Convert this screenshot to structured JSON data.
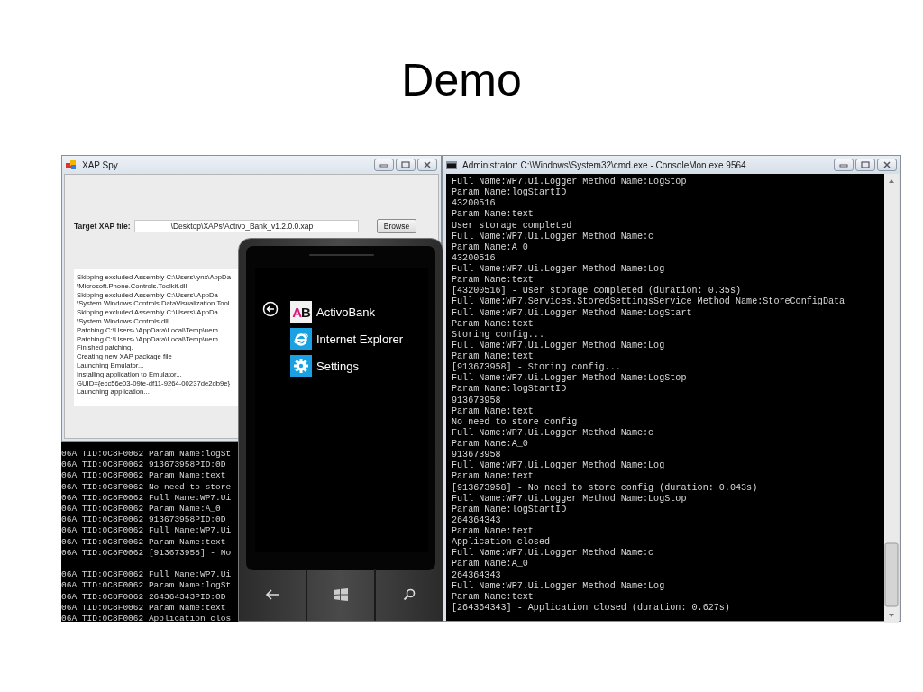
{
  "slide": {
    "title": "Demo"
  },
  "xap_spy": {
    "title": "XAP Spy",
    "target_label": "Target XAP file:",
    "target_value": "\\Desktop\\XAPs\\Activo_Bank_v1.2.0.0.xap",
    "browse_button": "Browse",
    "log": [
      "Skipping excluded Assembly C:\\Users\\lynx\\AppDa",
      "\\Microsoft.Phone.Controls.Toolkit.dll",
      "Skipping excluded Assembly C:\\Users\\      AppDa",
      "\\System.Windows.Controls.DataVisualization.Tool",
      "Skipping excluded Assembly C:\\Users\\      AppDa",
      "\\System.Windows.Controls.dll",
      "Patching C:\\Users\\      \\AppData\\Local\\Temp\\uem",
      "Patching C:\\Users\\      \\AppData\\Local\\Temp\\uem",
      "Finished patching.",
      "Creating new XAP package file",
      "Launching Emulator...",
      "Installing application to Emulator...",
      "GUID={ecc56e03-09fe-df11-9264-00237de2db9e}",
      "Launching application..."
    ]
  },
  "console_behind": {
    "blocks": [
      [
        "06A TID:0C8F0062 Param Name:logSt",
        "06A TID:0C8F0062 913673958PID:0D",
        "06A TID:0C8F0062 Param Name:text",
        "06A TID:0C8F0062 No need to store",
        "06A TID:0C8F0062 Full Name:WP7.Ui",
        "06A TID:0C8F0062 Param Name:A_0",
        "06A TID:0C8F0062 913673958PID:0D",
        "06A TID:0C8F0062 Full Name:WP7.Ui",
        "06A TID:0C8F0062 Param Name:text",
        "06A TID:0C8F0062 [913673958] - No"
      ],
      [
        "06A TID:0C8F0062 Full Name:WP7.Ui",
        "06A TID:0C8F0062 Param Name:logSt",
        "06A TID:0C8F0062 264364343PID:0D",
        "06A TID:0C8F0062 Param Name:text",
        "06A TID:0C8F0062 Application clos"
      ]
    ]
  },
  "phone": {
    "apps": [
      {
        "kind": "activobank",
        "tile_text": "AB",
        "label": "ActivoBank"
      },
      {
        "kind": "ie",
        "label": "Internet Explorer"
      },
      {
        "kind": "settings",
        "label": "Settings"
      }
    ]
  },
  "cmd": {
    "title": "Administrator: C:\\Windows\\System32\\cmd.exe - ConsoleMon.exe  9564",
    "lines": [
      "Full Name:WP7.Ui.Logger Method Name:LogStop",
      "Param Name:logStartID",
      "43200516",
      "Param Name:text",
      "User storage completed",
      "Full Name:WP7.Ui.Logger Method Name:c",
      "Param Name:A_0",
      "43200516",
      "Full Name:WP7.Ui.Logger Method Name:Log",
      "Param Name:text",
      "[43200516] - User storage completed (duration: 0.35s)",
      "Full Name:WP7.Services.StoredSettingsService Method Name:StoreConfigData",
      "Full Name:WP7.Ui.Logger Method Name:LogStart",
      "Param Name:text",
      "Storing config...",
      "Full Name:WP7.Ui.Logger Method Name:Log",
      "Param Name:text",
      "[913673958] - Storing config...",
      "Full Name:WP7.Ui.Logger Method Name:LogStop",
      "Param Name:logStartID",
      "913673958",
      "Param Name:text",
      "No need to store config",
      "Full Name:WP7.Ui.Logger Method Name:c",
      "Param Name:A_0",
      "913673958",
      "Full Name:WP7.Ui.Logger Method Name:Log",
      "Param Name:text",
      "[913673958] - No need to store config (duration: 0.043s)",
      "Full Name:WP7.Ui.Logger Method Name:LogStop",
      "Param Name:logStartID",
      "264364343",
      "Param Name:text",
      "Application closed",
      "Full Name:WP7.Ui.Logger Method Name:c",
      "Param Name:A_0",
      "264364343",
      "Full Name:WP7.Ui.Logger Method Name:Log",
      "Param Name:text",
      "[264364343] - Application closed (duration: 0.627s)"
    ]
  }
}
